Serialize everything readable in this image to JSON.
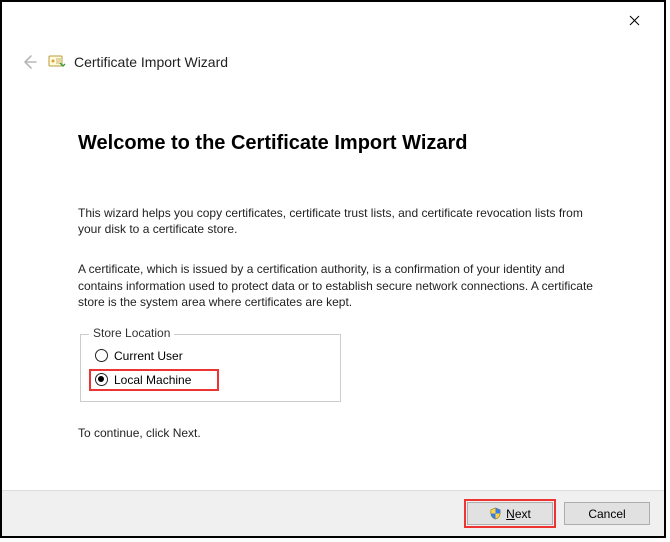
{
  "window": {
    "title": "Certificate Import Wizard"
  },
  "page": {
    "heading": "Welcome to the Certificate Import Wizard",
    "intro1": "This wizard helps you copy certificates, certificate trust lists, and certificate revocation lists from your disk to a certificate store.",
    "intro2": "A certificate, which is issued by a certification authority, is a confirmation of your identity and contains information used to protect data or to establish secure network connections. A certificate store is the system area where certificates are kept.",
    "storeLocation": {
      "legend": "Store Location",
      "option1": "Current User",
      "option2": "Local Machine",
      "selected": "Local Machine"
    },
    "continueHint": "To continue, click Next."
  },
  "footer": {
    "nextLabel": "Next",
    "cancelLabel": "Cancel"
  }
}
